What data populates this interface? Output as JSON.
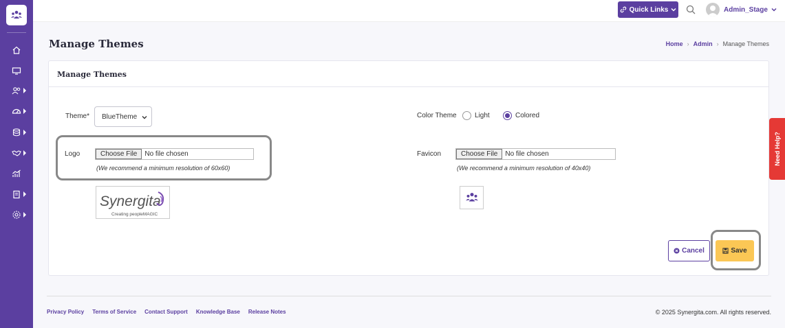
{
  "topbar": {
    "quick_links_label": "Quick Links",
    "user_name": "Admin_Stage"
  },
  "sidebar": {
    "items": [
      "home-icon",
      "monitor-icon",
      "users-icon",
      "dashboard-icon",
      "database-icon",
      "handshake-icon",
      "analytics-icon",
      "clipboard-icon",
      "settings-icon"
    ]
  },
  "page": {
    "title": "Manage Themes",
    "breadcrumb": [
      "Home",
      "Admin",
      "Manage Themes"
    ]
  },
  "card": {
    "title": "Manage Themes",
    "theme_label": "Theme*",
    "theme_value": "BlueTheme",
    "color_theme_label": "Color Theme",
    "color_options": [
      "Light",
      "Colored"
    ],
    "color_selected": "Colored",
    "logo_label": "Logo",
    "logo_file_button": "Choose File",
    "logo_file_status": "No file chosen",
    "logo_hint": "(We recommend a minimum resolution of 60x60)",
    "logo_brand": "Synergita",
    "logo_tagline": "Creating peopleMAGIC",
    "favicon_label": "Favicon",
    "favicon_file_button": "Choose File",
    "favicon_file_status": "No file chosen",
    "favicon_hint": "(We recommend a minimum resolution of 40x40)",
    "cancel_label": "Cancel",
    "save_label": "Save"
  },
  "footer": {
    "links": [
      "Privacy Policy",
      "Terms of Service",
      "Contact Support",
      "Knowledge Base",
      "Release Notes"
    ],
    "copyright": "© 2025 Synergita.com. All rights reserved."
  },
  "help_tab": "Need Help?",
  "colors": {
    "brand": "#5b3fa0",
    "save": "#fbc755",
    "help": "#e53935"
  }
}
